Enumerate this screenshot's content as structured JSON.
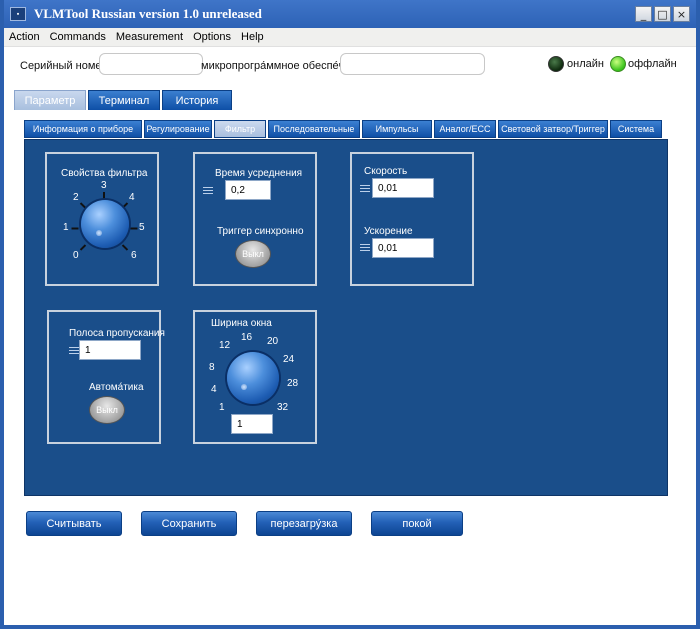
{
  "window": {
    "title": "VLMTool  Russian version 1.0 unreleased",
    "icon_name": "app-icon",
    "controls": {
      "minimize": "_",
      "maximize": "□",
      "close": "×"
    }
  },
  "menu": [
    "Action",
    "Commands",
    "Measurement",
    "Options",
    "Help"
  ],
  "header": {
    "serial_label": "Серийный номер",
    "serial_value": "",
    "firmware_label": "микропрогра́ммное обеспе́чение",
    "firmware_value": "",
    "online_label": "онлайн",
    "offline_label": "оффлайн"
  },
  "main_tabs": [
    {
      "label": "Параметр",
      "active": true
    },
    {
      "label": "Терминал",
      "active": false
    },
    {
      "label": "История",
      "active": false
    }
  ],
  "sub_tabs": [
    {
      "label": "Информация о приборе",
      "active": false
    },
    {
      "label": "Регулирование",
      "active": false
    },
    {
      "label": "Фильтр",
      "active": true
    },
    {
      "label": "Последовательные",
      "active": false
    },
    {
      "label": "Импульсы",
      "active": false
    },
    {
      "label": "Аналог/ECC",
      "active": false
    },
    {
      "label": "Световой затвор/Триггер",
      "active": false
    },
    {
      "label": "Система",
      "active": false
    }
  ],
  "filter_panel": {
    "filter_props": {
      "title": "Свойства фильтра",
      "dial_labels": [
        "0",
        "1",
        "2",
        "3",
        "4",
        "5",
        "6"
      ]
    },
    "averaging": {
      "time_label": "Время усреднения",
      "time_value": "0,2",
      "trigger_label": "Триггер синхронно",
      "trigger_state": "Выкл"
    },
    "motion": {
      "speed_label": "Скорость",
      "speed_value": "0,01",
      "accel_label": "Ускорение",
      "accel_value": "0,01"
    },
    "bandwidth": {
      "label": "Полоса пропускания",
      "value": "1",
      "auto_label": "Автома́тика",
      "auto_state": "Выкл"
    },
    "window_width": {
      "label": "Ширина окна",
      "dial_labels": [
        "1",
        "4",
        "8",
        "12",
        "16",
        "20",
        "24",
        "28",
        "32"
      ],
      "value": "1"
    }
  },
  "buttons": {
    "read": "Считывать",
    "save": "Сохранить",
    "reboot": "перезагру́зка",
    "rest": "покой"
  }
}
